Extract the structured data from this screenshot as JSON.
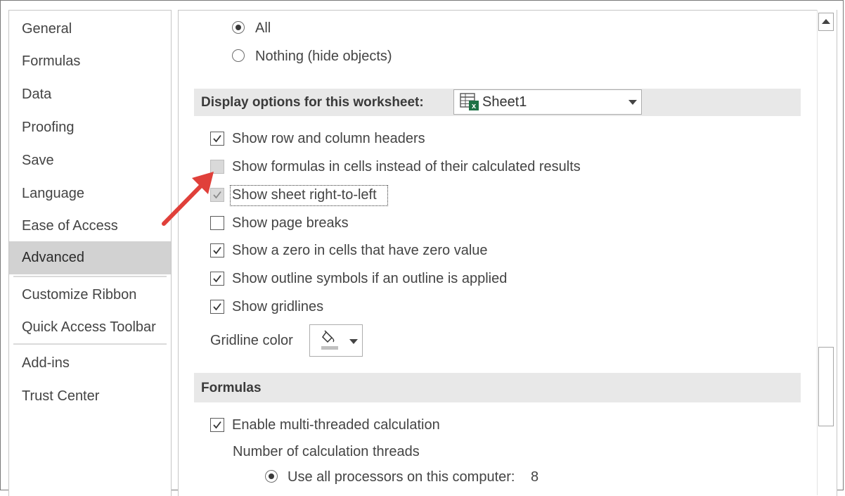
{
  "nav": {
    "items": [
      {
        "label": "General"
      },
      {
        "label": "Formulas"
      },
      {
        "label": "Data"
      },
      {
        "label": "Proofing"
      },
      {
        "label": "Save"
      },
      {
        "label": "Language"
      },
      {
        "label": "Ease of Access"
      },
      {
        "label": "Advanced"
      },
      {
        "label": "Customize Ribbon"
      },
      {
        "label": "Quick Access Toolbar"
      },
      {
        "label": "Add-ins"
      },
      {
        "label": "Trust Center"
      }
    ],
    "active": "Advanced"
  },
  "objects": {
    "options": [
      {
        "label": "All",
        "selected": true
      },
      {
        "label": "Nothing (hide objects)",
        "selected": false
      }
    ]
  },
  "display_section": {
    "title": "Display options for this worksheet:",
    "sheet_selected": "Sheet1",
    "options": [
      {
        "label": "Show row and column headers",
        "checked": true,
        "disabled": false
      },
      {
        "label": "Show formulas in cells instead of their calculated results",
        "checked": false,
        "disabled": true
      },
      {
        "label": "Show sheet right-to-left",
        "checked": true,
        "disabled": true,
        "focused": true
      },
      {
        "label": "Show page breaks",
        "checked": false,
        "disabled": false
      },
      {
        "label": "Show a zero in cells that have zero value",
        "checked": true,
        "disabled": false
      },
      {
        "label": "Show outline symbols if an outline is applied",
        "checked": true,
        "disabled": false
      },
      {
        "label": "Show gridlines",
        "checked": true,
        "disabled": false
      }
    ],
    "gridline_color_label": "Gridline color",
    "gridline_color": "#c0c0c0"
  },
  "formulas_section": {
    "title": "Formulas",
    "multi_threaded_label": "Enable multi-threaded calculation",
    "multi_threaded_checked": true,
    "threads_label": "Number of calculation threads",
    "use_all_label": "Use all processors on this computer:",
    "use_all_selected": true,
    "processor_count": "8"
  },
  "colors": {
    "accent_arrow": "#e0403a",
    "active_nav": "#d2d2d2",
    "section_header": "#e8e8e8"
  }
}
